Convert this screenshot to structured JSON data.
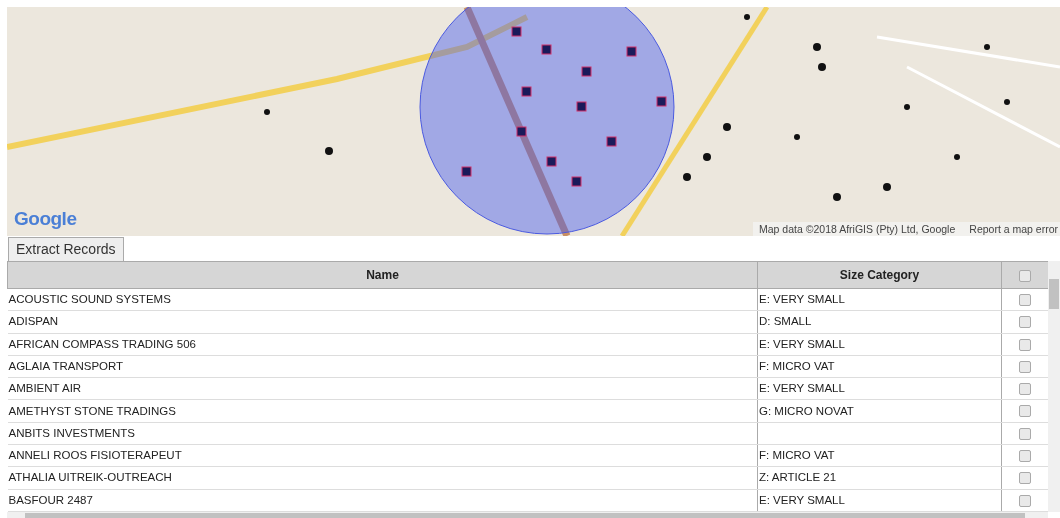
{
  "map": {
    "logo": "Google",
    "attribution": "Map data ©2018 AfriGIS (Pty) Ltd, Google",
    "report_link": "Report a map error"
  },
  "tabs": [
    {
      "label": "Extract Records",
      "selected": true
    }
  ],
  "table": {
    "columns": [
      "Name",
      "Size Category"
    ],
    "select_all_checked": false,
    "rows": [
      {
        "name": "ACOUSTIC SOUND SYSTEMS",
        "size_category": "E: VERY SMALL",
        "checked": false
      },
      {
        "name": "ADISPAN",
        "size_category": "D: SMALL",
        "checked": false
      },
      {
        "name": "AFRICAN COMPASS TRADING 506",
        "size_category": "E: VERY SMALL",
        "checked": false
      },
      {
        "name": "AGLAIA TRANSPORT",
        "size_category": "F: MICRO VAT",
        "checked": false
      },
      {
        "name": "AMBIENT AIR",
        "size_category": "E: VERY SMALL",
        "checked": false
      },
      {
        "name": "AMETHYST STONE TRADINGS",
        "size_category": "G: MICRO NOVAT",
        "checked": false
      },
      {
        "name": "ANBITS INVESTMENTS",
        "size_category": "",
        "checked": false
      },
      {
        "name": "ANNELI ROOS FISIOTERAPEUT",
        "size_category": "F: MICRO VAT",
        "checked": false
      },
      {
        "name": "ATHALIA UITREIK-OUTREACH",
        "size_category": "Z: ARTICLE 21",
        "checked": false
      },
      {
        "name": "BASFOUR 2487",
        "size_category": "E: VERY SMALL",
        "checked": false
      }
    ]
  }
}
